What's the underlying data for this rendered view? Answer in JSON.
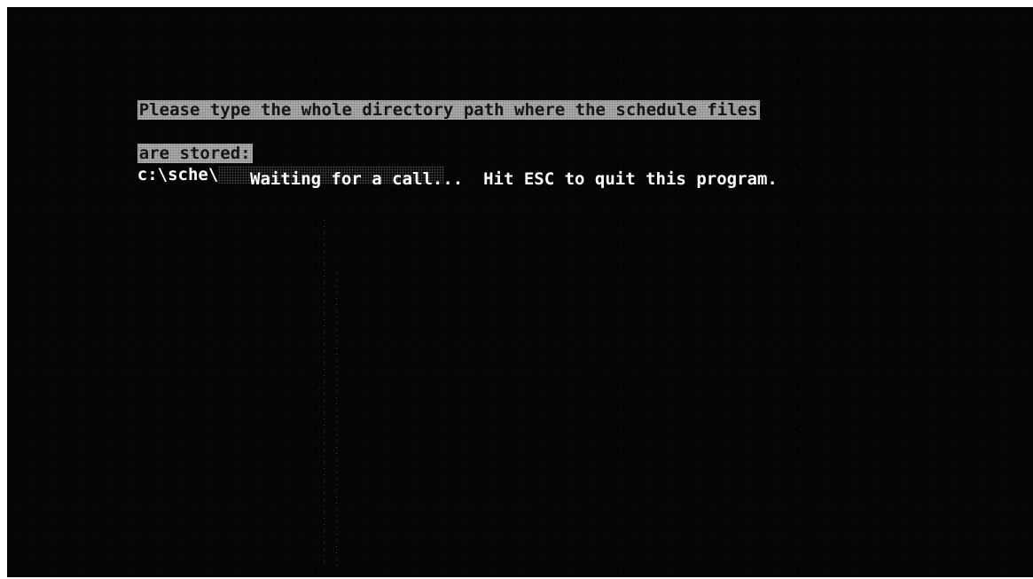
{
  "dialog": {
    "prompt_line1": "Please type the whole directory path where the schedule files",
    "prompt_line2": "are stored:",
    "path_value": "c:\\sche\\",
    "status_message": "Waiting for a call...  Hit ESC to quit this program."
  },
  "colors": {
    "screen_background": "#050505",
    "text": "#ffffff",
    "prompt_highlight": "#a8a8a8",
    "prompt_text": "#151515"
  }
}
